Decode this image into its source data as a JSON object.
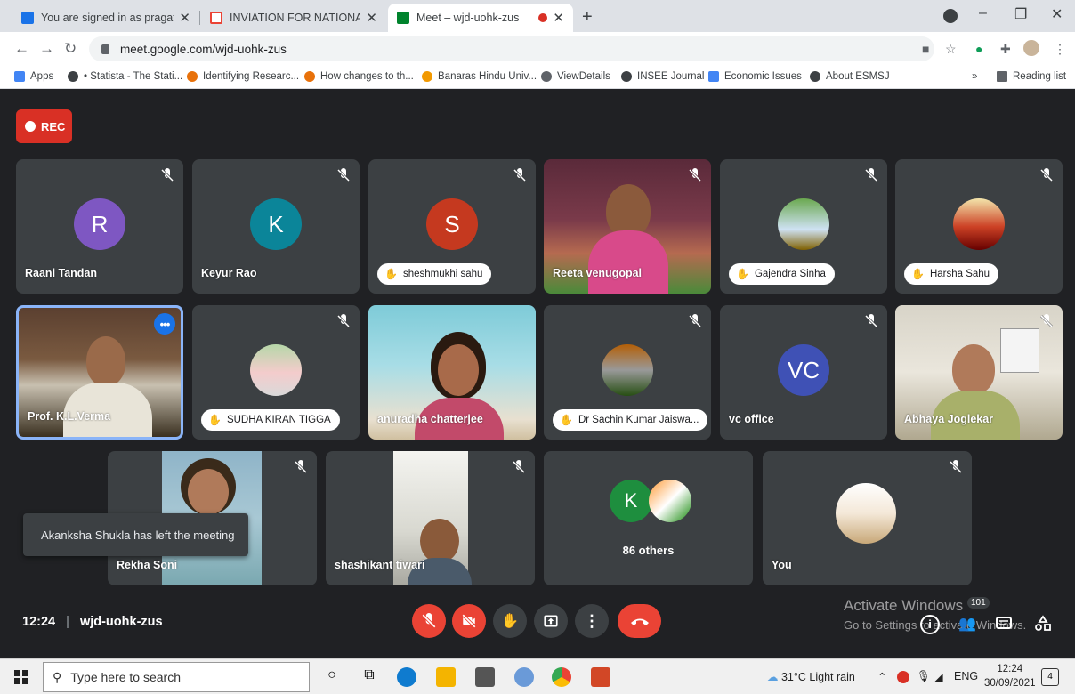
{
  "browser": {
    "tabs": [
      {
        "label": "You are signed in as pragatik_eco",
        "favicon_color": "#1a73e8"
      },
      {
        "label": "INVIATION FOR NATIONAL WEB",
        "favicon_color": "#ea4335"
      },
      {
        "label": "Meet – wjd-uohk-zus",
        "favicon_color": "#00832d"
      }
    ],
    "new_tab": "+",
    "url": "meet.google.com/wjd-uohk-zus",
    "bookmarks": [
      {
        "label": "Apps",
        "color": "#4285f4"
      },
      {
        "label": "• Statista - The Stati...",
        "color": "#3c4043"
      },
      {
        "label": "Identifying Researc...",
        "color": "#e8710a"
      },
      {
        "label": "How changes to th...",
        "color": "#e8710a"
      },
      {
        "label": "Banaras Hindu Univ...",
        "color": "#f29900"
      },
      {
        "label": "ViewDetails",
        "color": "#5f6368"
      },
      {
        "label": "INSEE Journal",
        "color": "#3c4043"
      },
      {
        "label": "Economic Issues",
        "color": "#4285f4"
      },
      {
        "label": "About ESMSJ",
        "color": "#3c4043"
      }
    ],
    "bookmarks_more": "»",
    "reading_list": "Reading list"
  },
  "meeting": {
    "rec_label": "REC",
    "participants": [
      {
        "name": "Raani Tandan",
        "initial": "R",
        "avatar_color": "#7e57c2"
      },
      {
        "name": "Keyur Rao",
        "initial": "K",
        "avatar_color": "#0b8599"
      },
      {
        "name": "sheshmukhi sahu",
        "initial": "S",
        "avatar_color": "#c5391f"
      },
      {
        "name": "Reeta venugopal"
      },
      {
        "name": "Gajendra Sinha"
      },
      {
        "name": "Harsha Sahu"
      },
      {
        "name": "Prof. K.L.Verma"
      },
      {
        "name": "SUDHA KIRAN TIGGA"
      },
      {
        "name": "anuradha chatterjee"
      },
      {
        "name": "Dr Sachin Kumar Jaiswa..."
      },
      {
        "name": "vc office",
        "initial": "VC",
        "avatar_color": "#3f51b5"
      },
      {
        "name": "Abhaya Joglekar"
      },
      {
        "name": "Rekha Soni"
      },
      {
        "name": "shashikant tiwari"
      },
      {
        "name": "86 others",
        "initial": "K",
        "avatar_color": "#1e8e3e"
      },
      {
        "name": "You"
      }
    ],
    "toast": "Akanksha Shukla has left the meeting",
    "time": "12:24",
    "meeting_code": "wjd-uohk-zus",
    "people_count": "101",
    "watermark_title": "Activate Windows",
    "watermark_sub": "Go to Settings to activate Windows."
  },
  "taskbar": {
    "search_placeholder": "Type here to search",
    "weather": "31°C  Light rain",
    "lang": "ENG",
    "time": "12:24",
    "date": "30/09/2021",
    "notif_count": "4"
  }
}
